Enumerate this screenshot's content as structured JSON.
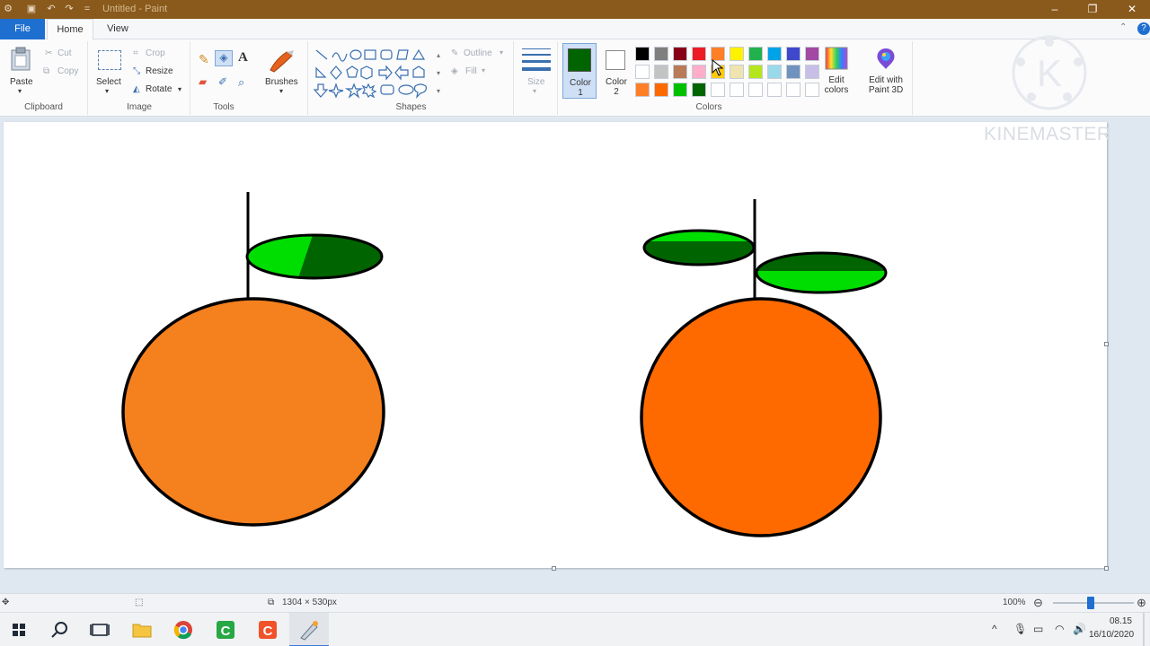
{
  "window": {
    "title": "Untitled - Paint",
    "quick_access": [
      "save-icon",
      "undo-icon",
      "redo-icon",
      "customize-icon"
    ],
    "controls": {
      "minimize": "–",
      "maximize": "❐",
      "close": "✕"
    }
  },
  "tabs": {
    "file": "File",
    "home": "Home",
    "view": "View"
  },
  "ribbon": {
    "clipboard": {
      "label": "Clipboard",
      "paste": "Paste",
      "cut": "Cut",
      "copy": "Copy"
    },
    "image": {
      "label": "Image",
      "select": "Select",
      "crop": "Crop",
      "resize": "Resize",
      "rotate": "Rotate"
    },
    "tools": {
      "label": "Tools",
      "brushes": "Brushes"
    },
    "shapes": {
      "label": "Shapes",
      "outline": "Outline",
      "fill": "Fill"
    },
    "size": {
      "label": "Size"
    },
    "colors": {
      "label": "Colors",
      "color1": "Color 1",
      "color2": "Color 2",
      "edit_colors": "Edit colors",
      "edit_paint3d": "Edit with Paint 3D",
      "color1_value": "#006400",
      "color2_value": "#ffffff",
      "palette_row1": [
        "#000000",
        "#7f7f7f",
        "#880015",
        "#ed1c24",
        "#ff7f27",
        "#fff200",
        "#22b14c",
        "#00a2e8",
        "#3f48cc",
        "#a349a4"
      ],
      "palette_row2": [
        "#ffffff",
        "#c3c3c3",
        "#b97a57",
        "#ffaec9",
        "#ffc90e",
        "#efe4b0",
        "#b5e61d",
        "#99d9ea",
        "#7092be",
        "#c8bfe7"
      ],
      "palette_row3": [
        "#ff7f27",
        "#ff6a00",
        "#00c000",
        "#006400",
        "#ffffff",
        "#ffffff",
        "#ffffff",
        "#ffffff",
        "#ffffff",
        "#ffffff"
      ]
    }
  },
  "canvas": {
    "orange_color": "#f5801e",
    "orange_color_2": "#ff6a00",
    "leaf_light": "#00dd00",
    "leaf_dark": "#006400"
  },
  "statusbar": {
    "dimensions": "1304 × 530px",
    "zoom": "100%"
  },
  "taskbar": {
    "time": "08.15",
    "date": "16/10/2020"
  },
  "watermark": {
    "text": "KINEMASTER",
    "logo_letter": "K"
  }
}
